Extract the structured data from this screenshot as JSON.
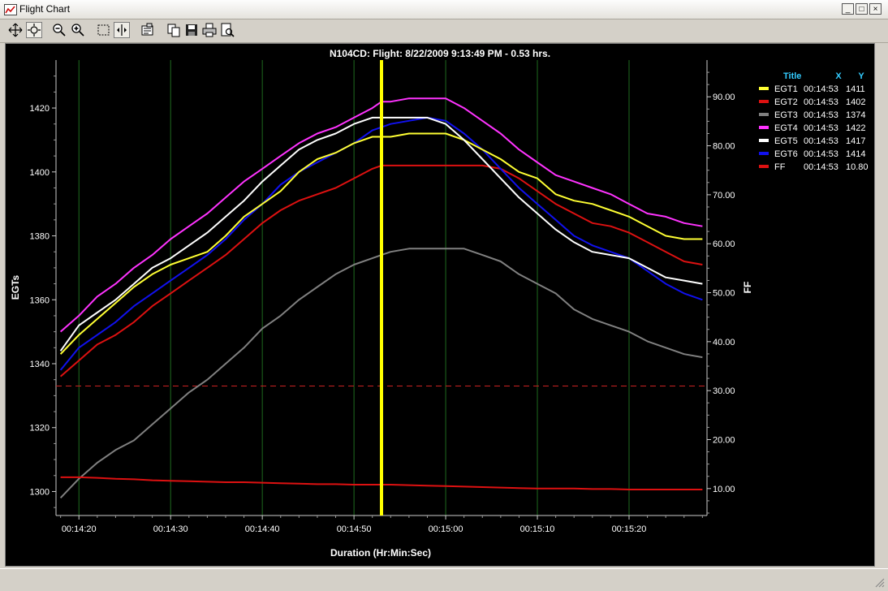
{
  "window": {
    "title": "Flight Chart",
    "controls": [
      "_",
      "□",
      "×"
    ]
  },
  "toolbar": {
    "icons": [
      "move-icon",
      "zoom-area-icon",
      "zoom-out-icon",
      "zoom-in-icon",
      "select-icon",
      "cursor-icon",
      "properties-icon",
      "copy-icon",
      "save-icon",
      "print-icon",
      "print-preview-icon"
    ]
  },
  "colors": {
    "EGT1": "#ffff33",
    "EGT2": "#dd1111",
    "EGT3": "#808080",
    "EGT4": "#ff33ff",
    "EGT5": "#ffffff",
    "EGT6": "#1111ee",
    "FF": "#dd1111",
    "cursor": "#ffff00",
    "grid": "#1f6b1f",
    "threshold": "#cc2222"
  },
  "chart_data": {
    "type": "line",
    "title": "N104CD:  Flight: 8/22/2009 9:13:49 PM - 0.53 hrs.",
    "xlabel": "Duration (Hr:Min:Sec)",
    "ylabel": "EGTs",
    "y2label": "FF",
    "xlim": [
      857.5,
      928.5
    ],
    "xticks": [
      860,
      870,
      880,
      890,
      900,
      910,
      920
    ],
    "xtick_labels": [
      "00:14:20",
      "00:14:30",
      "00:14:40",
      "00:14:50",
      "00:15:00",
      "00:15:10",
      "00:15:20"
    ],
    "ylim": [
      1292.5,
      1435
    ],
    "yticks": [
      1300,
      1320,
      1340,
      1360,
      1380,
      1400,
      1420
    ],
    "y2lim": [
      4.5,
      97.5
    ],
    "y2ticks": [
      10,
      20,
      30,
      40,
      50,
      60,
      70,
      80,
      90
    ],
    "y2tick_labels": [
      "10.00",
      "20.00",
      "30.00",
      "40.00",
      "50.00",
      "60.00",
      "70.00",
      "80.00",
      "90.00"
    ],
    "grid": "vertical",
    "cursor_x": 893,
    "reference_line": {
      "axis": "y",
      "value": 1333
    },
    "legend": {
      "placement": "right",
      "headers": [
        "Title",
        "X",
        "Y"
      ],
      "entries": [
        {
          "title": "EGT1",
          "x": "00:14:53",
          "y": "1411"
        },
        {
          "title": "EGT2",
          "x": "00:14:53",
          "y": "1402"
        },
        {
          "title": "EGT3",
          "x": "00:14:53",
          "y": "1374"
        },
        {
          "title": "EGT4",
          "x": "00:14:53",
          "y": "1422"
        },
        {
          "title": "EGT5",
          "x": "00:14:53",
          "y": "1417"
        },
        {
          "title": "EGT6",
          "x": "00:14:53",
          "y": "1414"
        },
        {
          "title": "FF",
          "x": "00:14:53",
          "y": "10.80"
        }
      ]
    },
    "x": [
      858,
      860,
      862,
      864,
      866,
      868,
      870,
      872,
      874,
      876,
      878,
      880,
      882,
      884,
      886,
      888,
      890,
      892,
      893,
      894,
      896,
      898,
      900,
      902,
      904,
      906,
      908,
      910,
      912,
      914,
      916,
      918,
      920,
      922,
      924,
      926,
      928
    ],
    "series": [
      {
        "name": "EGT1",
        "axis": "left",
        "values": [
          1343,
          1349,
          1354,
          1359,
          1364,
          1368,
          1371,
          1373,
          1375,
          1380,
          1386,
          1390,
          1394,
          1400,
          1404,
          1406,
          1409,
          1411,
          1411,
          1411,
          1412,
          1412,
          1412,
          1410,
          1407,
          1404,
          1400,
          1398,
          1393,
          1391,
          1390,
          1388,
          1386,
          1383,
          1380,
          1379,
          1379
        ]
      },
      {
        "name": "EGT2",
        "axis": "left",
        "values": [
          1336,
          1341,
          1346,
          1349,
          1353,
          1358,
          1362,
          1366,
          1370,
          1374,
          1379,
          1384,
          1388,
          1391,
          1393,
          1395,
          1398,
          1401,
          1402,
          1402,
          1402,
          1402,
          1402,
          1402,
          1402,
          1401,
          1398,
          1394,
          1390,
          1387,
          1384,
          1383,
          1381,
          1378,
          1375,
          1372,
          1371
        ]
      },
      {
        "name": "EGT3",
        "axis": "left",
        "values": [
          1298,
          1304,
          1309,
          1313,
          1316,
          1321,
          1326,
          1331,
          1335,
          1340,
          1345,
          1351,
          1355,
          1360,
          1364,
          1368,
          1371,
          1373,
          1374,
          1375,
          1376,
          1376,
          1376,
          1376,
          1374,
          1372,
          1368,
          1365,
          1362,
          1357,
          1354,
          1352,
          1350,
          1347,
          1345,
          1343,
          1342
        ]
      },
      {
        "name": "EGT4",
        "axis": "left",
        "values": [
          1350,
          1355,
          1361,
          1365,
          1370,
          1374,
          1379,
          1383,
          1387,
          1392,
          1397,
          1401,
          1405,
          1409,
          1412,
          1414,
          1417,
          1420,
          1422,
          1422,
          1423,
          1423,
          1423,
          1420,
          1416,
          1412,
          1407,
          1403,
          1399,
          1397,
          1395,
          1393,
          1390,
          1387,
          1386,
          1384,
          1383
        ]
      },
      {
        "name": "EGT5",
        "axis": "left",
        "values": [
          1344,
          1352,
          1356,
          1360,
          1365,
          1370,
          1373,
          1377,
          1381,
          1386,
          1391,
          1397,
          1402,
          1407,
          1410,
          1412,
          1415,
          1417,
          1417,
          1417,
          1417,
          1417,
          1415,
          1410,
          1404,
          1398,
          1392,
          1387,
          1382,
          1378,
          1375,
          1374,
          1373,
          1370,
          1367,
          1366,
          1365
        ]
      },
      {
        "name": "EGT6",
        "axis": "left",
        "values": [
          1338,
          1345,
          1349,
          1353,
          1358,
          1362,
          1366,
          1370,
          1374,
          1379,
          1385,
          1390,
          1396,
          1400,
          1403,
          1406,
          1409,
          1413,
          1414,
          1415,
          1416,
          1417,
          1416,
          1412,
          1407,
          1401,
          1395,
          1390,
          1385,
          1380,
          1377,
          1375,
          1373,
          1369,
          1365,
          1362,
          1360
        ]
      },
      {
        "name": "FF",
        "axis": "right",
        "values": [
          12.3,
          12.3,
          12.2,
          12.0,
          11.9,
          11.7,
          11.6,
          11.5,
          11.4,
          11.3,
          11.3,
          11.2,
          11.1,
          11.0,
          10.9,
          10.9,
          10.8,
          10.8,
          10.8,
          10.8,
          10.7,
          10.6,
          10.5,
          10.4,
          10.3,
          10.2,
          10.1,
          10.0,
          10.0,
          10.0,
          9.9,
          9.9,
          9.8,
          9.8,
          9.8,
          9.8,
          9.8
        ]
      }
    ]
  }
}
